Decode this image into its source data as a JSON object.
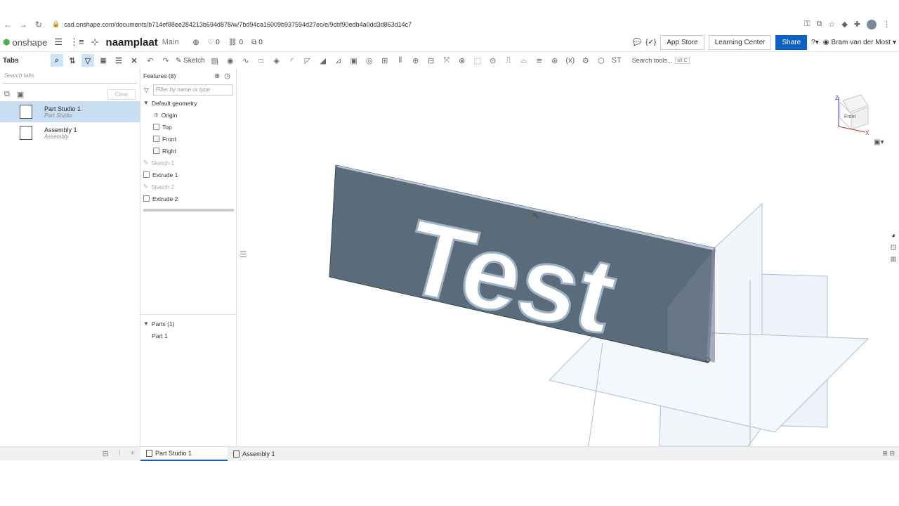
{
  "browser": {
    "url": "cad.onshape.com/documents/b714ef88ee284213b694d878/w/7bd94ca16009b937594d27ec/e/9cbf90edb4a0dd3d863d14c7"
  },
  "app": {
    "logo": "onshape",
    "doc_name": "naamplaat",
    "branch": "Main",
    "likes": "0",
    "links": "0",
    "copies": "0",
    "app_store": "App Store",
    "learning_center": "Learning Center",
    "share": "Share",
    "user": "Bram van der Most"
  },
  "toolbar": {
    "tabs_title": "Tabs",
    "sketch": "Sketch",
    "search_tools": "Search tools...",
    "shortcut": "alt C"
  },
  "left": {
    "search_placeholder": "Search tabs",
    "clear": "Clear",
    "tabs": [
      {
        "name": "Part Studio 1",
        "sub": "Part Studio"
      },
      {
        "name": "Assembly 1",
        "sub": "Assembly"
      }
    ]
  },
  "features": {
    "title": "Features (8)",
    "filter_placeholder": "Filter by name or type",
    "default_geometry": "Default geometry",
    "items": [
      {
        "label": "Origin"
      },
      {
        "label": "Top"
      },
      {
        "label": "Front"
      },
      {
        "label": "Right"
      },
      {
        "label": "Sketch 1"
      },
      {
        "label": "Extrude 1"
      },
      {
        "label": "Sketch 2"
      },
      {
        "label": "Extrude 2"
      }
    ],
    "parts_title": "Parts (1)",
    "parts": [
      "Part 1"
    ]
  },
  "viewport": {
    "text3d": "Test",
    "cube_face": "Front",
    "axis_z": "Z",
    "axis_x": "X"
  },
  "bottom": {
    "tabs": [
      {
        "label": "Part Studio 1"
      },
      {
        "label": "Assembly 1"
      }
    ]
  }
}
